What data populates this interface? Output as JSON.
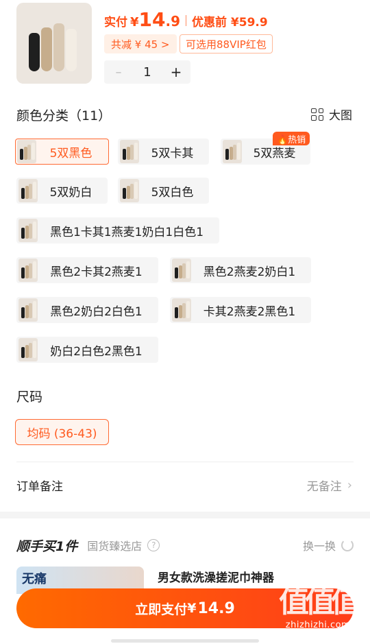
{
  "price": {
    "label": "实付",
    "yen": "¥",
    "int": "14",
    "dec": ".9",
    "before_text": "优惠前 ¥59.9",
    "save_text": "共减 ¥ 45 >",
    "vip_text": "可选用88VIP红包"
  },
  "stepper": {
    "minus": "–",
    "value": "1",
    "plus": "+"
  },
  "color_section": {
    "title": "颜色分类（11）",
    "big_view": "大图",
    "hot_badge": "🔥热销",
    "options": [
      {
        "label": "5双黑色"
      },
      {
        "label": "5双卡其"
      },
      {
        "label": "5双燕麦"
      },
      {
        "label": "5双奶白"
      },
      {
        "label": "5双白色"
      },
      {
        "label": "黑色1卡其1燕麦1奶白1白色1"
      },
      {
        "label": "黑色2卡其2燕麦1"
      },
      {
        "label": "黑色2燕麦2奶白1"
      },
      {
        "label": "黑色2奶白2白色1"
      },
      {
        "label": "卡其2燕麦2黑色1"
      },
      {
        "label": "奶白2白色2黑色1"
      }
    ],
    "selected": "5双黑色"
  },
  "size_section": {
    "title": "尺码",
    "option": "均码 (36-43)"
  },
  "note": {
    "label": "订单备注",
    "value": "无备注"
  },
  "shop": {
    "title": "顺手买1件",
    "name": "国货臻选店",
    "swap": "换一换"
  },
  "promo": {
    "image_text": "无痛",
    "title": "男女款洗澡搓泥巾神器"
  },
  "pay": {
    "label": "立即支付",
    "yen": "¥",
    "amount": "14.9"
  },
  "watermark": {
    "big": "值值值",
    "small": "zhizhizhi.com"
  },
  "colors": {
    "accent": "#ff5a1f",
    "selected_bg": "#fff4ee",
    "pay_start": "#ff6a00",
    "pay_end": "#ff3d1a"
  }
}
